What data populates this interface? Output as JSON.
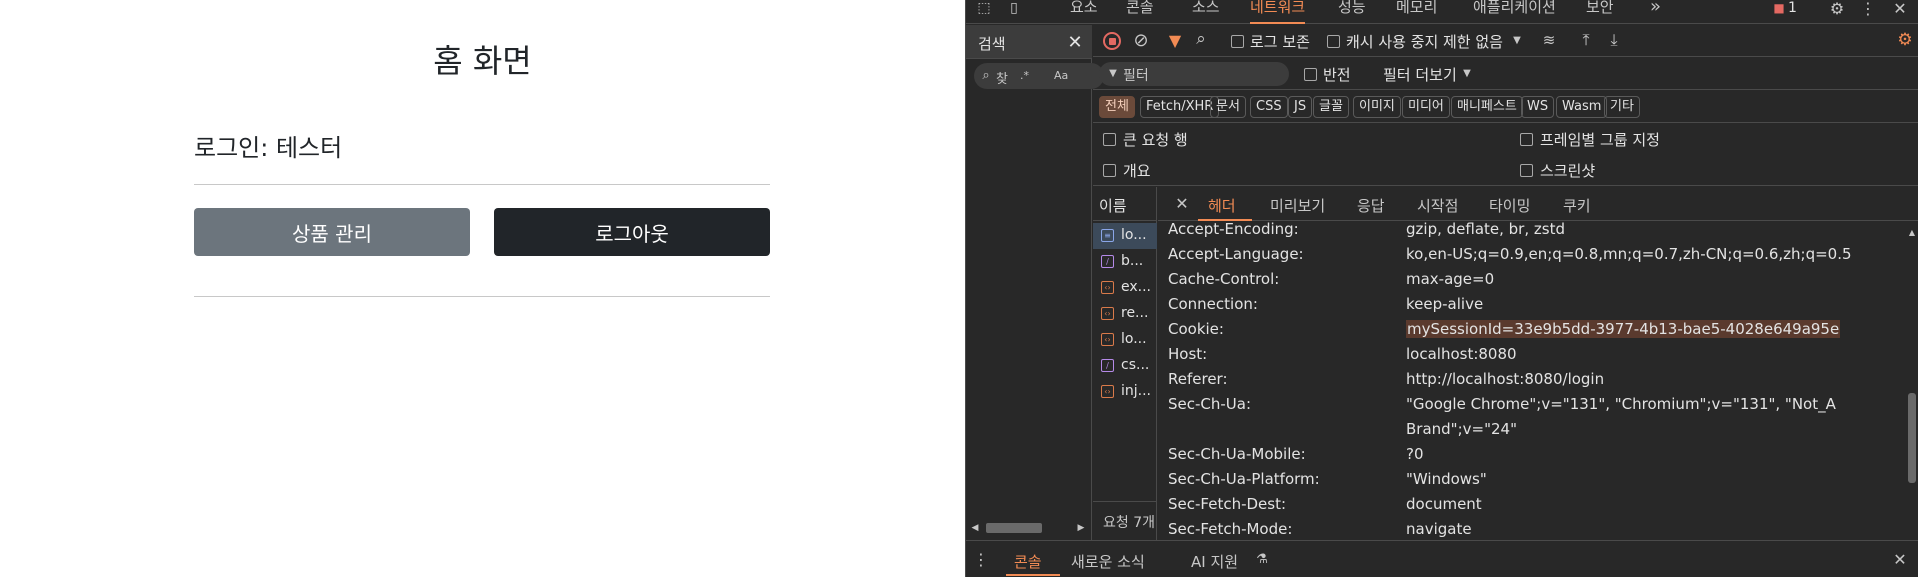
{
  "page": {
    "title": "홈 화면",
    "login_status": "로그인: 테스터",
    "buttons": {
      "product_manage": "상품 관리",
      "logout": "로그아웃"
    }
  },
  "devtools": {
    "top_tabs": [
      "요소",
      "콘솔",
      "소스",
      "네트워크",
      "성능",
      "메모리",
      "애플리케이션",
      "보안"
    ],
    "active_top_tab": "네트워크",
    "more_tabs": "»",
    "issue_count": "1",
    "search": {
      "tab_label": "검색",
      "placeholder": "찾",
      "regex": ".*",
      "case": "Aa"
    },
    "toolbar": {
      "preserve_log": "로그 보존",
      "disable_cache": "캐시 사용 중지",
      "throttling": "제한 없음"
    },
    "filter": {
      "placeholder": "필터",
      "invert": "반전",
      "more_filters": "필터 더보기"
    },
    "type_filters": [
      "전체",
      "Fetch/XHR",
      "문서",
      "CSS",
      "JS",
      "글꼴",
      "이미지",
      "미디어",
      "매니페스트",
      "WS",
      "Wasm",
      "기타"
    ],
    "options": {
      "large_rows": "큰 요청 행",
      "group_by_frame": "프레임별 그룹 지정",
      "overview": "개요",
      "screenshots": "스크린샷"
    },
    "request_list": {
      "header": "이름",
      "items": [
        "lo...",
        "b...",
        "ex...",
        "re...",
        "lo...",
        "cs...",
        "inj..."
      ],
      "footer": "요청 7개"
    },
    "detail_tabs": [
      "헤더",
      "미리보기",
      "응답",
      "시작점",
      "타이밍",
      "쿠키"
    ],
    "active_detail_tab": "헤더",
    "headers": [
      {
        "name": "Accept-Encoding:",
        "value": "gzip, deflate, br, zstd"
      },
      {
        "name": "Accept-Language:",
        "value": "ko,en-US;q=0.9,en;q=0.8,mn;q=0.7,zh-CN;q=0.6,zh;q=0.5"
      },
      {
        "name": "Cache-Control:",
        "value": "max-age=0"
      },
      {
        "name": "Connection:",
        "value": "keep-alive"
      },
      {
        "name": "Cookie:",
        "value": "mySessionId=33e9b5dd-3977-4b13-bae5-4028e649a95e"
      },
      {
        "name": "Host:",
        "value": "localhost:8080"
      },
      {
        "name": "Referer:",
        "value": "http://localhost:8080/login"
      },
      {
        "name": "Sec-Ch-Ua:",
        "value": "\"Google Chrome\";v=\"131\", \"Chromium\";v=\"131\", \"Not_A",
        "value2": "Brand\";v=\"24\""
      },
      {
        "name": "Sec-Ch-Ua-Mobile:",
        "value": "?0"
      },
      {
        "name": "Sec-Ch-Ua-Platform:",
        "value": "\"Windows\""
      },
      {
        "name": "Sec-Fetch-Dest:",
        "value": "document"
      },
      {
        "name": "Sec-Fetch-Mode:",
        "value": "navigate"
      }
    ],
    "drawer": {
      "tabs": [
        "콘솔",
        "새로운 소식",
        "AI 지원"
      ],
      "active": "콘솔"
    },
    "colors": {
      "accent": "#f28b54",
      "record": "#e46962",
      "highlight": "#5a3a2e"
    }
  }
}
